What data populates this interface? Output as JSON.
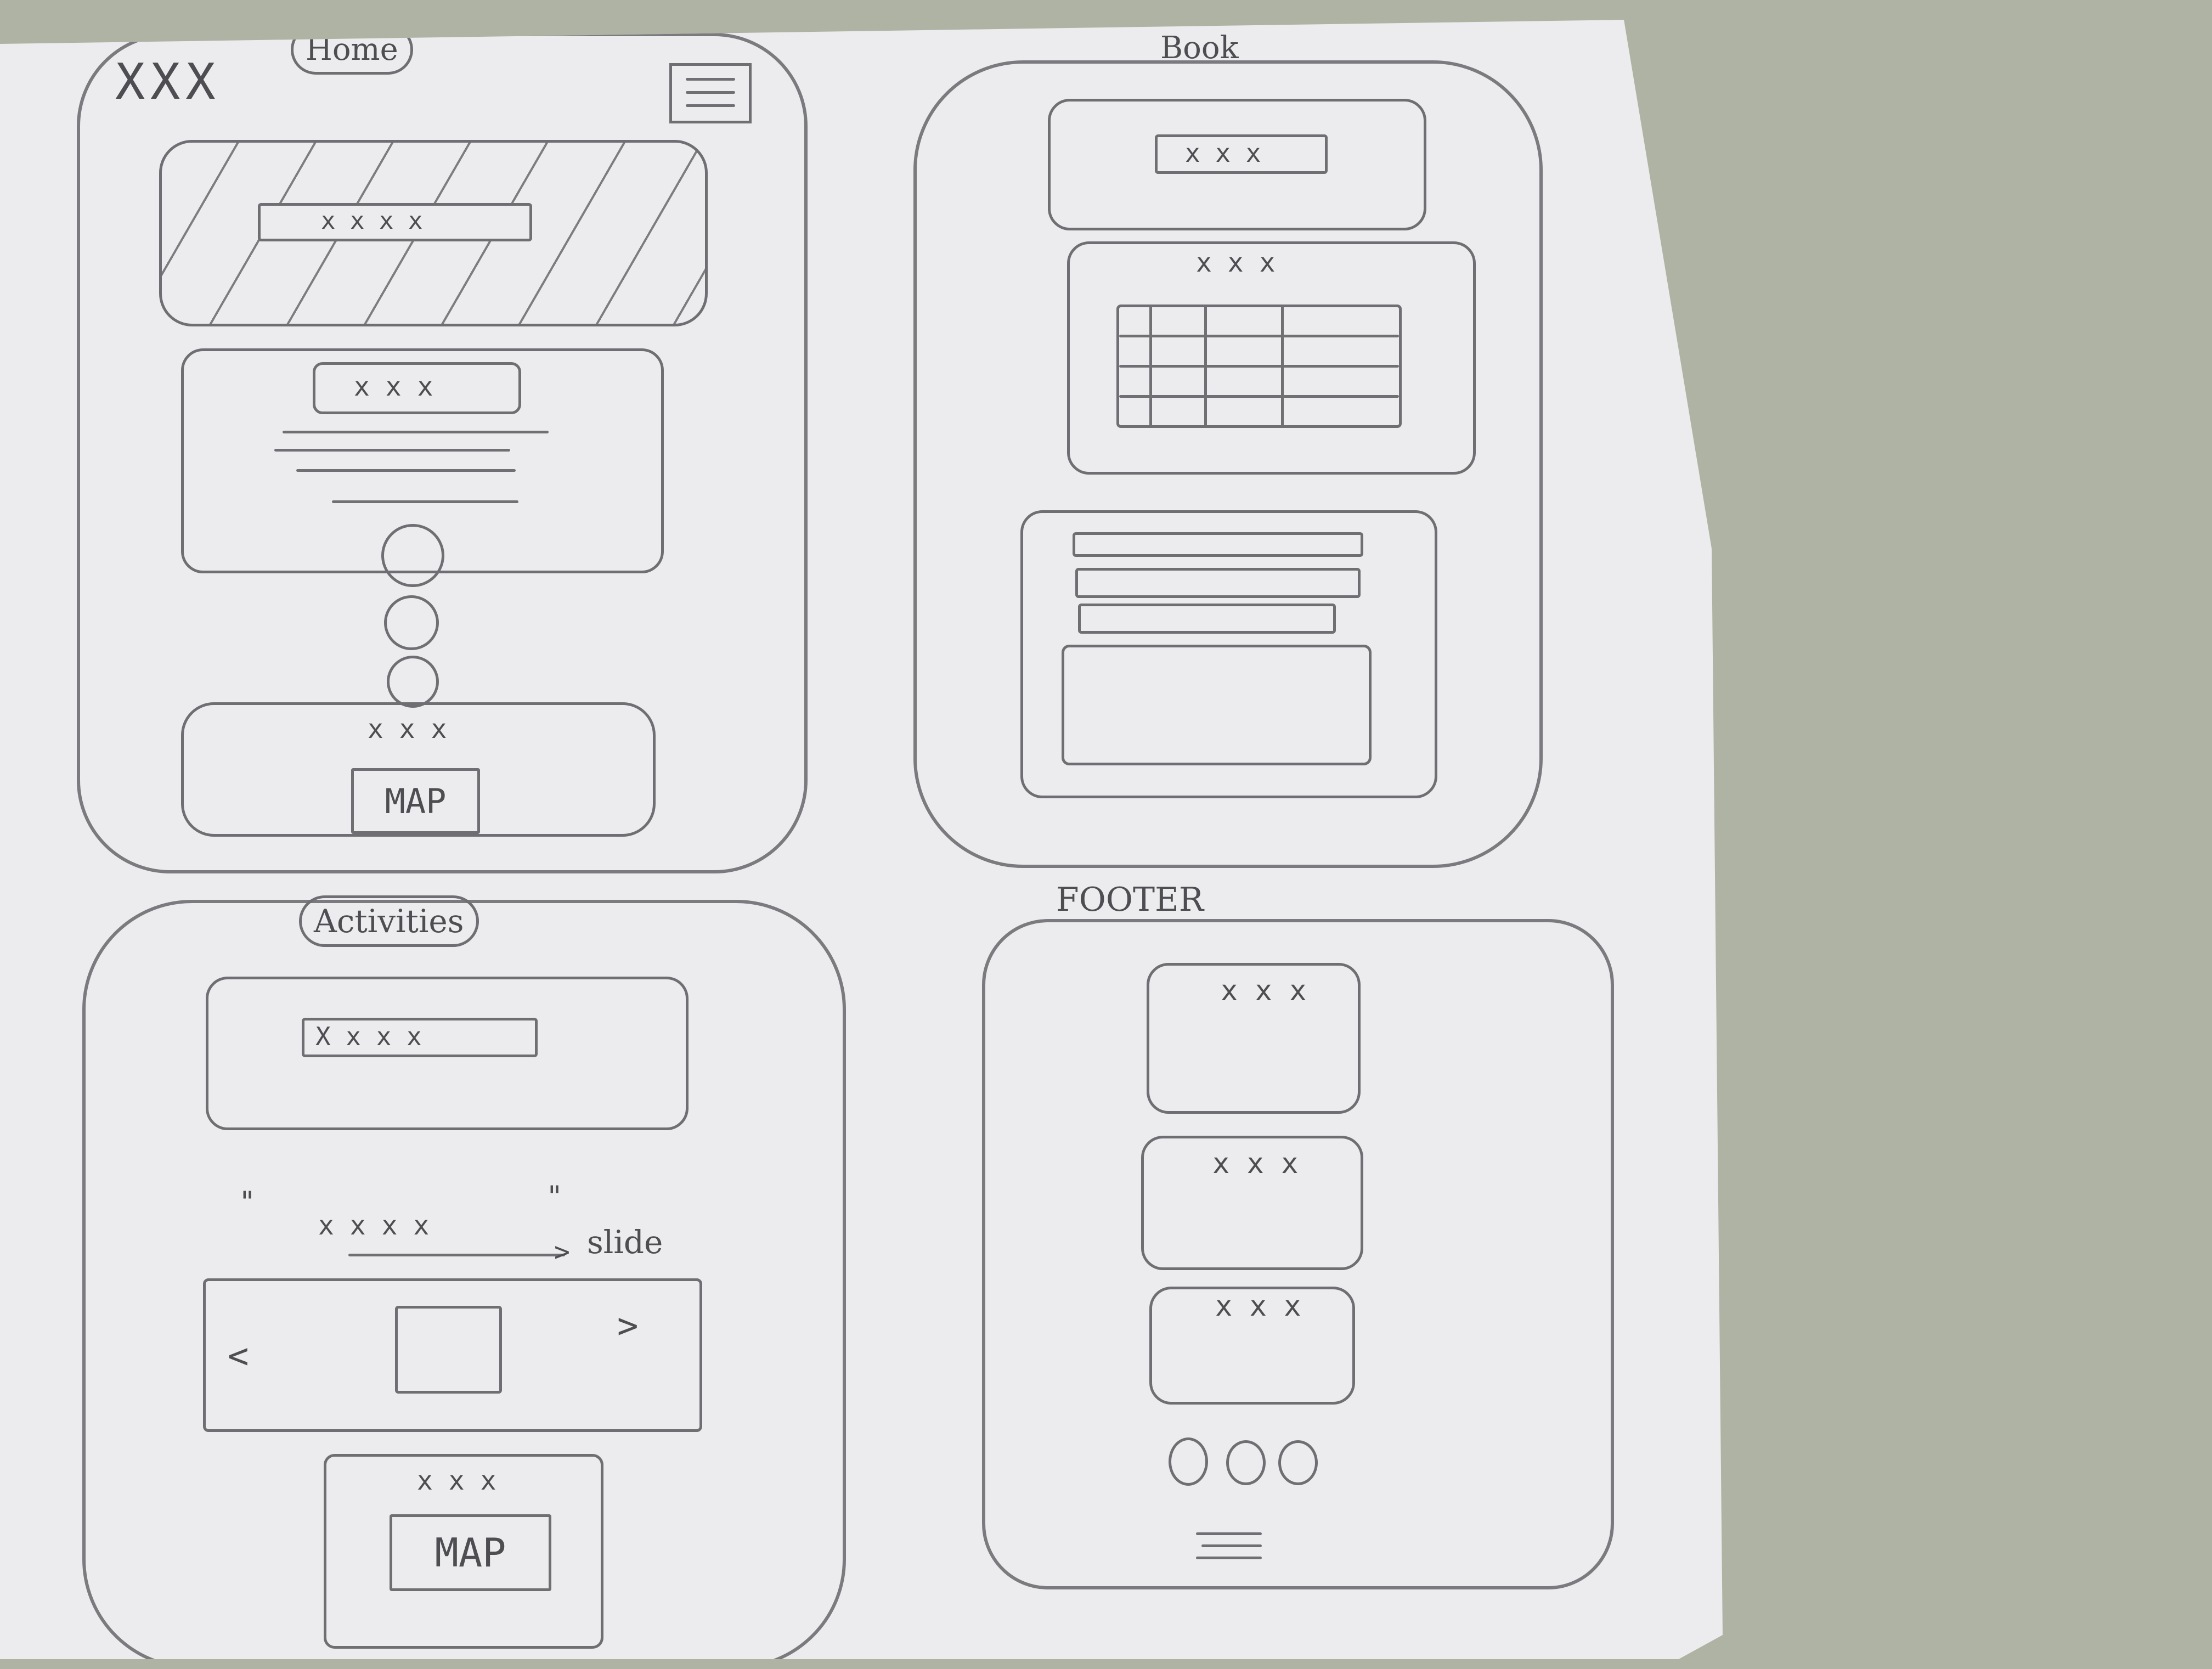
{
  "home": {
    "title": "Home",
    "logo": "XXX",
    "hero_text": "x x x x",
    "about_heading": "x x x",
    "location_text": "x x x",
    "map_button": "MAP"
  },
  "book": {
    "title": "Book",
    "banner_text": "x x x",
    "table_heading": "x x x"
  },
  "activities": {
    "title": "Activities",
    "banner_text": "X x x x",
    "open_quote": "\"",
    "close_quote": "\"",
    "quote_text": "x x x x",
    "slide_label": "slide",
    "prev_arrow": "<",
    "next_arrow": ">",
    "map_heading": "x x x",
    "map_button": "MAP"
  },
  "footer": {
    "title": "FOOTER",
    "card_labels": [
      "x x x",
      "x x x",
      "x x x"
    ],
    "social_circles": 3,
    "menu_icon": "menu-icon"
  },
  "colors": {
    "paper": "#ecebee",
    "pencil": "#6f6f73",
    "background": "#aeb3a4"
  }
}
